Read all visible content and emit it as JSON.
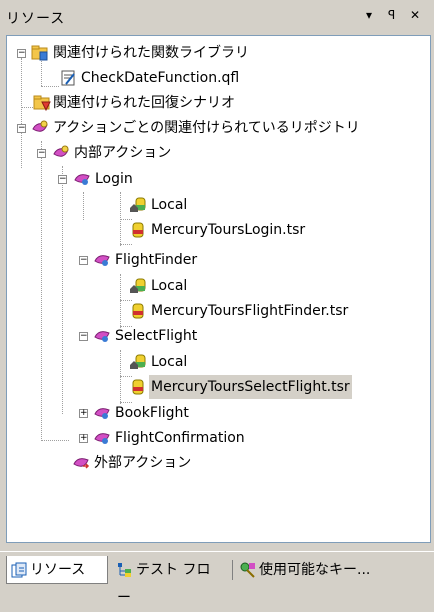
{
  "panel": {
    "title": "リソース",
    "controls": {
      "dropdown": "▾",
      "pin": "ꟼ",
      "close": "✕"
    }
  },
  "tree": {
    "n1": {
      "label": "関連付けられた関数ライブラリ",
      "expander": "−"
    },
    "n1a": {
      "label": "CheckDateFunction.qfl"
    },
    "n2": {
      "label": "関連付けられた回復シナリオ"
    },
    "n3": {
      "label": "アクションごとの関連付けられているリポジトリ",
      "expander": "−"
    },
    "n4": {
      "label": "内部アクション",
      "expander": "−"
    },
    "login": {
      "label": "Login",
      "expander": "−"
    },
    "login_local": {
      "label": "Local"
    },
    "login_file": {
      "label": "MercuryToursLogin.tsr"
    },
    "ff": {
      "label": "FlightFinder",
      "expander": "−"
    },
    "ff_local": {
      "label": "Local"
    },
    "ff_file": {
      "label": "MercuryToursFlightFinder.tsr"
    },
    "sf": {
      "label": "SelectFlight",
      "expander": "−"
    },
    "sf_local": {
      "label": "Local"
    },
    "sf_file": {
      "label": "MercuryToursSelectFlight.tsr"
    },
    "bf": {
      "label": "BookFlight",
      "expander": "+"
    },
    "fc": {
      "label": "FlightConfirmation",
      "expander": "+"
    },
    "ext": {
      "label": "外部アクション"
    }
  },
  "tabs": {
    "resources": "リソース",
    "testflow": "テスト フロー",
    "keywords": "使用可能なキー..."
  },
  "colors": {
    "panel_bg": "#d4d0c8",
    "tree_bg": "#ffffff",
    "selection": "#d4d0c8"
  }
}
